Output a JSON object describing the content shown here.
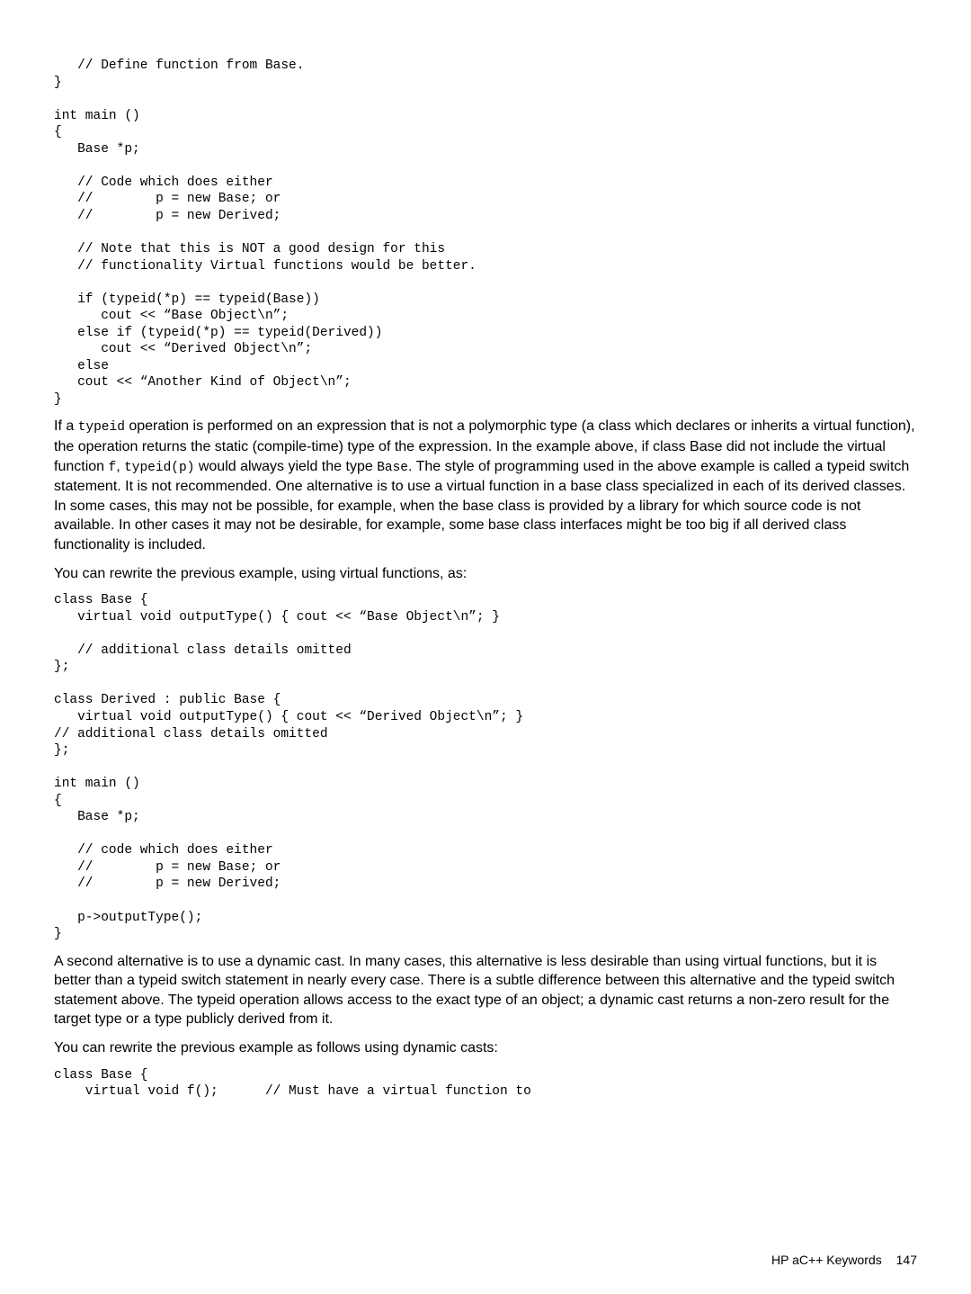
{
  "code1": "   // Define function from Base.\n}\n\nint main ()\n{\n   Base *p;\n\n   // Code which does either\n   //        p = new Base; or\n   //        p = new Derived;\n\n   // Note that this is NOT a good design for this\n   // functionality Virtual functions would be better.\n\n   if (typeid(*p) == typeid(Base))\n      cout << “Base Object\\n”;\n   else if (typeid(*p) == typeid(Derived))\n      cout << “Derived Object\\n”;\n   else\n   cout << “Another Kind of Object\\n”;\n}",
  "para1_a": "If a ",
  "para1_code1": "typeid",
  "para1_b": " operation is performed on an expression that is not a polymorphic type (a class which declares or inherits a virtual function), the operation returns the static (compile-time) type of the expression. In the example above, if class Base did not include the virtual function ",
  "para1_code2": "f",
  "para1_c": ", ",
  "para1_code3": "typeid(p)",
  "para1_d": " would always yield the type ",
  "para1_code4": "Base",
  "para1_e": ". The style of programming used in the above example is called a typeid switch statement. It is not recommended. One alternative is to use a virtual function in a base class specialized in each of its derived classes. In some cases, this may not be possible, for example, when the base class is provided by a library for which source code is not available. In other cases it may not be desirable, for example, some base class interfaces might be too big if all derived class functionality is included.",
  "para2": "You can rewrite the previous example, using virtual functions, as:",
  "code2": "class Base {\n   virtual void outputType() { cout << “Base Object\\n”; }\n\n   // additional class details omitted\n};\n\nclass Derived : public Base {\n   virtual void outputType() { cout << “Derived Object\\n”; }\n// additional class details omitted\n};\n\nint main ()\n{\n   Base *p;\n\n   // code which does either\n   //        p = new Base; or\n   //        p = new Derived;\n\n   p->outputType();\n}",
  "para3": "A second alternative is to use a dynamic cast. In many cases, this alternative is less desirable than using virtual functions, but it is better than a typeid switch statement in nearly every case. There is a subtle difference between this alternative and the typeid switch statement above. The typeid operation allows access to the exact type of an object; a dynamic cast returns a non-zero result for the target type or a type publicly derived from it.",
  "para4": "You can rewrite the previous example as follows using dynamic casts:",
  "code3": "class Base {\n    virtual void f();      // Must have a virtual function to",
  "footer": {
    "title": "HP aC++ Keywords",
    "page": "147"
  }
}
